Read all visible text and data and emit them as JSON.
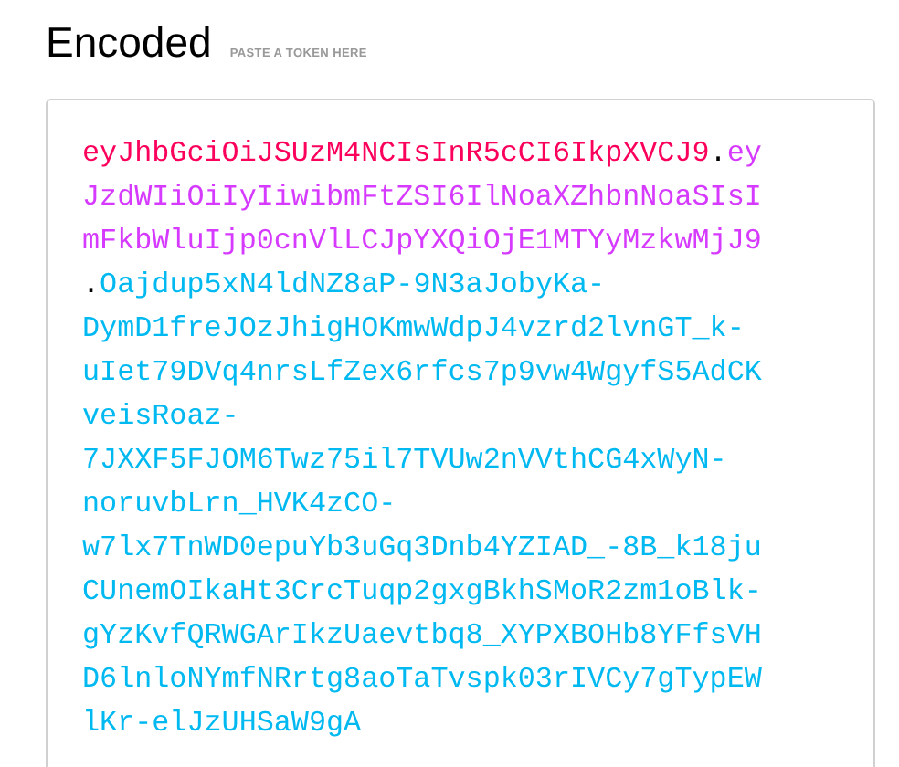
{
  "title": "Encoded",
  "hint": "PASTE A TOKEN HERE",
  "token_lines": [
    {
      "segments": [
        {
          "kind": "header",
          "text": "eyJhbGciOiJSUzM4NCIsInR5cCI6IkpXVCJ9"
        },
        {
          "kind": "dot",
          "text": "."
        },
        {
          "kind": "payload",
          "text": "ey"
        }
      ]
    },
    {
      "segments": [
        {
          "kind": "payload",
          "text": "JzdWIiOiIyIiwibmFtZSI6IlNoaXZhbnNoaSIsI"
        }
      ]
    },
    {
      "segments": [
        {
          "kind": "payload",
          "text": "mFkbWluIjp0cnVlLCJpYXQiOjE1MTYyMzkwMjJ9"
        }
      ]
    },
    {
      "segments": [
        {
          "kind": "dot",
          "text": "."
        },
        {
          "kind": "signature",
          "text": "Oajdup5xN4ldNZ8aP-9N3aJobyKa-"
        }
      ]
    },
    {
      "segments": [
        {
          "kind": "signature",
          "text": "DymD1freJOzJhigHOKmwWdpJ4vzrd2lvnGT_k-"
        }
      ]
    },
    {
      "segments": [
        {
          "kind": "signature",
          "text": "uIet79DVq4nrsLfZex6rfcs7p9vw4WgyfS5AdCK"
        }
      ]
    },
    {
      "segments": [
        {
          "kind": "signature",
          "text": "veisRoaz-"
        }
      ]
    },
    {
      "segments": [
        {
          "kind": "signature",
          "text": "7JXXF5FJOM6Twz75il7TVUw2nVVthCG4xWyN-"
        }
      ]
    },
    {
      "segments": [
        {
          "kind": "signature",
          "text": "noruvbLrn_HVK4zCO-"
        }
      ]
    },
    {
      "segments": [
        {
          "kind": "signature",
          "text": "w7lx7TnWD0epuYb3uGq3Dnb4YZIAD_-8B_k18ju"
        }
      ]
    },
    {
      "segments": [
        {
          "kind": "signature",
          "text": "CUnemOIkaHt3CrcTuqp2gxgBkhSMoR2zm1oBlk-"
        }
      ]
    },
    {
      "segments": [
        {
          "kind": "signature",
          "text": "gYzKvfQRWGArIkzUaevtbq8_XYPXBOHb8YFfsVH"
        }
      ]
    },
    {
      "segments": [
        {
          "kind": "signature",
          "text": "D6lnloNYmfNRrtg8aoTaTvspk03rIVCy7gTypEW"
        }
      ]
    },
    {
      "segments": [
        {
          "kind": "signature",
          "text": "lKr-elJzUHSaW9gA"
        }
      ]
    }
  ]
}
